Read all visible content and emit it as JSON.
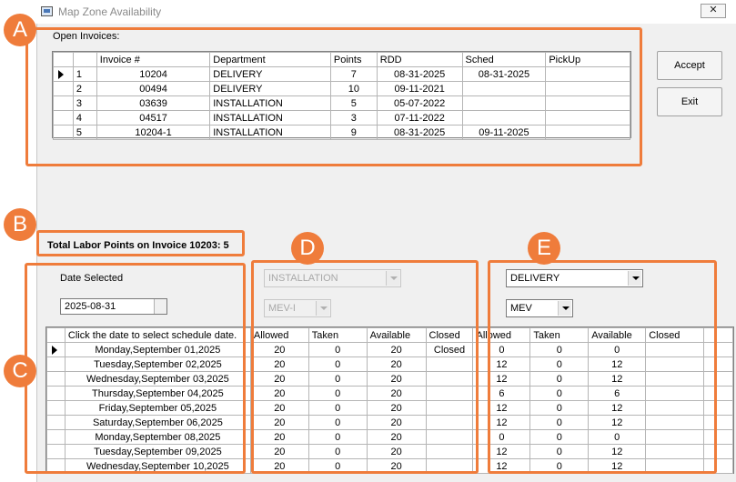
{
  "window": {
    "title": "Map Zone Availability",
    "close_glyph": "✕"
  },
  "open_invoices": {
    "label": "Open Invoices:",
    "columns": [
      "Invoice #",
      "Department",
      "Points",
      "RDD",
      "Sched",
      "PickUp"
    ],
    "rows": [
      {
        "num": "1",
        "invoice": "10204",
        "department": "DELIVERY",
        "points": "7",
        "rdd": "08-31-2025",
        "sched": "08-31-2025",
        "pickup": ""
      },
      {
        "num": "2",
        "invoice": "00494",
        "department": "DELIVERY",
        "points": "10",
        "rdd": "09-11-2021",
        "sched": "",
        "pickup": ""
      },
      {
        "num": "3",
        "invoice": "03639",
        "department": "INSTALLATION",
        "points": "5",
        "rdd": "05-07-2022",
        "sched": "",
        "pickup": ""
      },
      {
        "num": "4",
        "invoice": "04517",
        "department": "INSTALLATION",
        "points": "3",
        "rdd": "07-11-2022",
        "sched": "",
        "pickup": ""
      },
      {
        "num": "5",
        "invoice": "10204-1",
        "department": "INSTALLATION",
        "points": "9",
        "rdd": "08-31-2025",
        "sched": "09-11-2025",
        "pickup": ""
      }
    ]
  },
  "buttons": {
    "accept": "Accept",
    "exit": "Exit"
  },
  "total_points_label": "Total Labor Points on Invoice 10203: 5",
  "date_selected": {
    "label": "Date Selected",
    "value": "2025-08-31"
  },
  "zone_d": {
    "department": "INSTALLATION",
    "zone": "MEV-I"
  },
  "zone_e": {
    "department": "DELIVERY",
    "zone": "MEV"
  },
  "schedule": {
    "date_header": "Click the date to select schedule date.",
    "cap_headers": [
      "Allowed",
      "Taken",
      "Available",
      "Closed"
    ],
    "rows": [
      {
        "date": "Monday,September 01,2025",
        "d": [
          "20",
          "0",
          "20",
          "Closed"
        ],
        "e": [
          "0",
          "0",
          "0",
          ""
        ]
      },
      {
        "date": "Tuesday,September 02,2025",
        "d": [
          "20",
          "0",
          "20",
          ""
        ],
        "e": [
          "12",
          "0",
          "12",
          ""
        ]
      },
      {
        "date": "Wednesday,September 03,2025",
        "d": [
          "20",
          "0",
          "20",
          ""
        ],
        "e": [
          "12",
          "0",
          "12",
          ""
        ]
      },
      {
        "date": "Thursday,September 04,2025",
        "d": [
          "20",
          "0",
          "20",
          ""
        ],
        "e": [
          "6",
          "0",
          "6",
          ""
        ]
      },
      {
        "date": "Friday,September 05,2025",
        "d": [
          "20",
          "0",
          "20",
          ""
        ],
        "e": [
          "12",
          "0",
          "12",
          ""
        ]
      },
      {
        "date": "Saturday,September 06,2025",
        "d": [
          "20",
          "0",
          "20",
          ""
        ],
        "e": [
          "12",
          "0",
          "12",
          ""
        ]
      },
      {
        "date": "Monday,September 08,2025",
        "d": [
          "20",
          "0",
          "20",
          ""
        ],
        "e": [
          "0",
          "0",
          "0",
          ""
        ]
      },
      {
        "date": "Tuesday,September 09,2025",
        "d": [
          "20",
          "0",
          "20",
          ""
        ],
        "e": [
          "12",
          "0",
          "12",
          ""
        ]
      },
      {
        "date": "Wednesday,September 10,2025",
        "d": [
          "20",
          "0",
          "20",
          ""
        ],
        "e": [
          "12",
          "0",
          "12",
          ""
        ]
      }
    ]
  },
  "callouts": {
    "a": "A",
    "b": "B",
    "c": "C",
    "d": "D",
    "e": "E"
  },
  "colors": {
    "callout": "#ef7c3b",
    "window_bg": "#f0f0f0"
  }
}
